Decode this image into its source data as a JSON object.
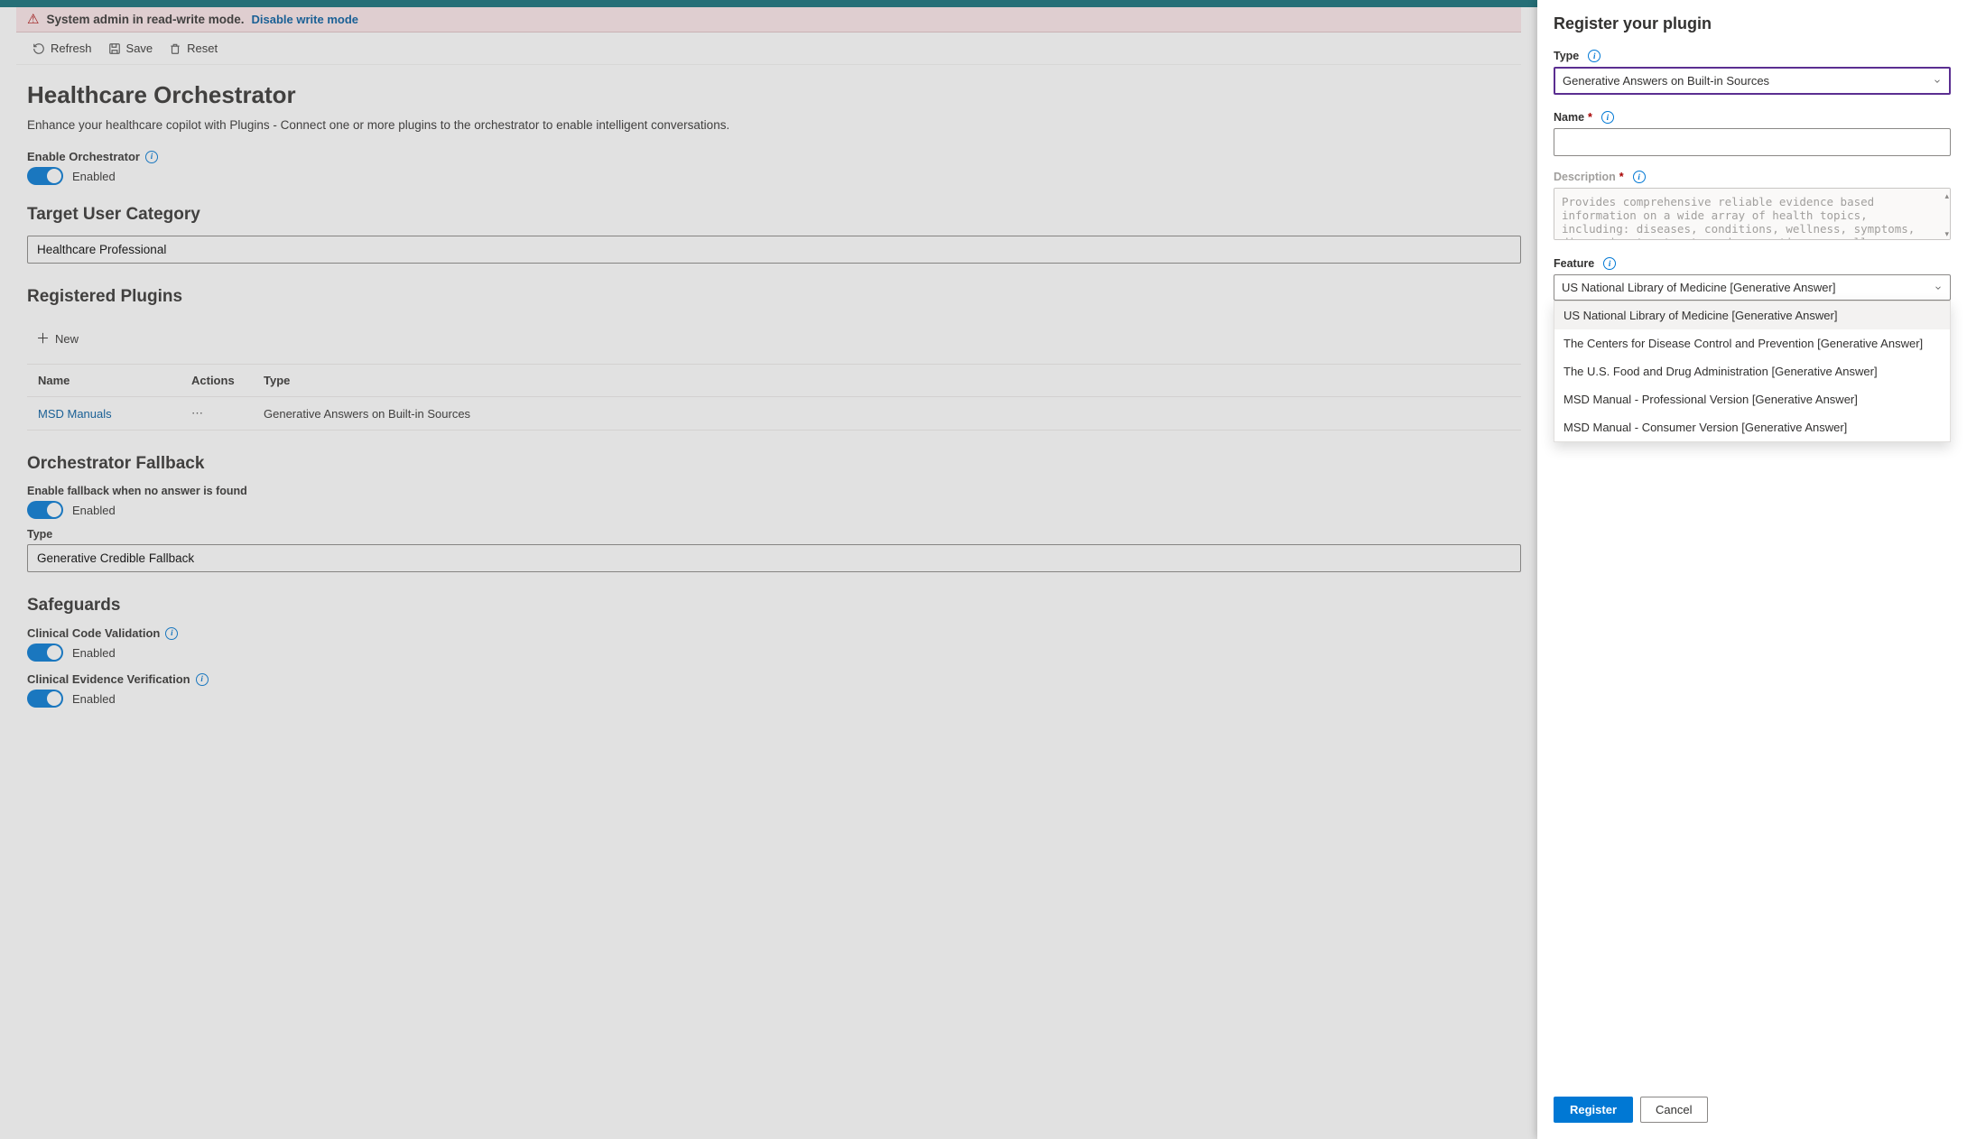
{
  "admin_bar": {
    "message": "System admin in read-write mode.",
    "link": "Disable write mode"
  },
  "toolbar": {
    "refresh": "Refresh",
    "save": "Save",
    "reset": "Reset"
  },
  "page": {
    "title": "Healthcare Orchestrator",
    "subtitle": "Enhance your healthcare copilot with Plugins - Connect one or more plugins to the orchestrator to enable intelligent conversations."
  },
  "orchestrator": {
    "enable_label": "Enable Orchestrator",
    "state": "Enabled"
  },
  "target_user": {
    "heading": "Target User Category",
    "value": "Healthcare Professional"
  },
  "plugins": {
    "heading": "Registered Plugins",
    "new_label": "New",
    "columns": {
      "name": "Name",
      "actions": "Actions",
      "type": "Type"
    },
    "rows": [
      {
        "name": "MSD Manuals",
        "type": "Generative Answers on Built-in Sources"
      }
    ]
  },
  "fallback": {
    "heading": "Orchestrator Fallback",
    "enable_label": "Enable fallback when no answer is found",
    "state": "Enabled",
    "type_label": "Type",
    "type_value": "Generative Credible Fallback"
  },
  "safeguards": {
    "heading": "Safeguards",
    "items": [
      {
        "label": "Clinical Code Validation",
        "state": "Enabled"
      },
      {
        "label": "Clinical Evidence Verification",
        "state": "Enabled"
      }
    ]
  },
  "panel": {
    "title": "Register your plugin",
    "type_label": "Type",
    "type_value": "Generative Answers on Built-in Sources",
    "name_label": "Name",
    "name_value": "",
    "desc_label": "Description",
    "desc_placeholder": "Provides comprehensive reliable evidence based information on a wide array of health topics, including: diseases, conditions, wellness, symptoms, diagnosis, treatment, and prevention, as well as insights into various bodily systems and",
    "feature_label": "Feature",
    "feature_value": "US National Library of Medicine [Generative Answer]",
    "feature_options": [
      "US National Library of Medicine [Generative Answer]",
      "The Centers for Disease Control and Prevention [Generative Answer]",
      "The U.S. Food and Drug Administration [Generative Answer]",
      "MSD Manual - Professional Version [Generative Answer]",
      "MSD Manual - Consumer Version [Generative Answer]"
    ],
    "register": "Register",
    "cancel": "Cancel"
  }
}
